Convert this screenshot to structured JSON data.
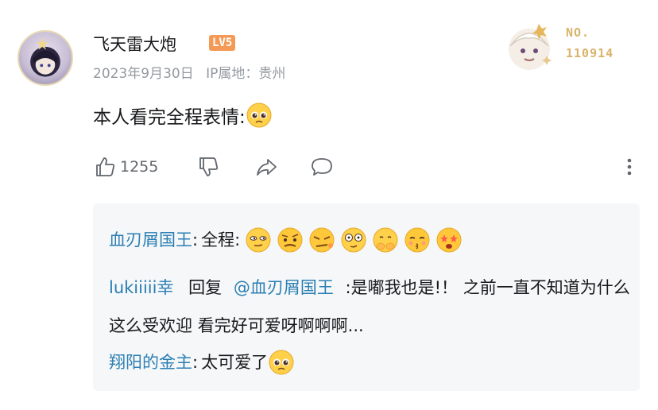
{
  "comment": {
    "username": "飞天雷大炮",
    "level": "LV5",
    "date": "2023年9月30日",
    "ip_location": "IP属地：贵州",
    "text": "本人看完全程表情:",
    "emoji": "pleading-face",
    "like_count": "1255",
    "fan_card": {
      "label": "NO.",
      "number": "110914"
    }
  },
  "icons": [
    "thumbs-up-icon",
    "thumbs-down-icon",
    "share-icon",
    "comment-icon",
    "more-vertical-icon"
  ],
  "replies": [
    {
      "name": "血刃屑国王",
      "separator": ":",
      "text": "全程:",
      "emojis": [
        "smug-face",
        "skeptical-face",
        "grumpy-face",
        "dizzy-face",
        "hands-covering-face",
        "kiss-face",
        "star-eyes-face"
      ]
    },
    {
      "name": "lukiiiii幸",
      "reply_word": "回复",
      "at": "@血刃屑国王",
      "text": ":是嘟我也是!！ 之前一直不知道为什么这么受欢迎 看完好可爱呀啊啊啊..."
    },
    {
      "name": "翔阳的金主",
      "separator": ":",
      "text": "太可爱了",
      "emoji": "pleading-face"
    }
  ],
  "colors": {
    "link": "#2a7fb4",
    "meta": "#9499a0",
    "badge": "#f59a56",
    "reply_bg": "#f6f7f8",
    "fan_gold": "#d8b36a"
  }
}
